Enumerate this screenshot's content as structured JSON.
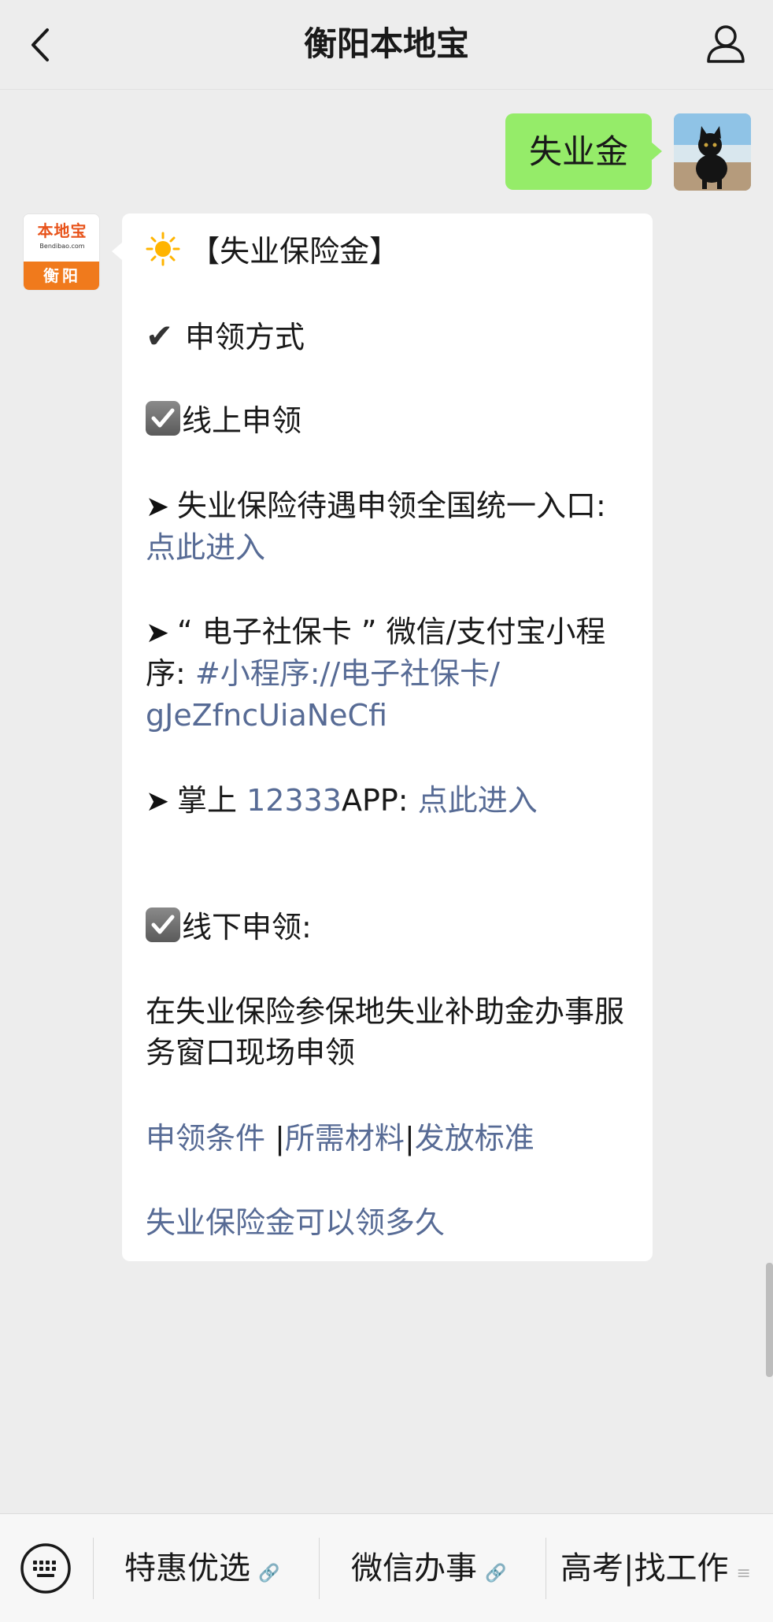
{
  "header": {
    "title": "衡阳本地宝",
    "back_icon": "chevron-left-icon",
    "profile_icon": "person-icon"
  },
  "chat": {
    "user_message": "失业金",
    "bot_avatar": {
      "logo": "本地宝",
      "domain": "Bendibao.com",
      "city": "衡阳"
    },
    "reply": {
      "heading": "【失业保险金】",
      "section": "申领方式",
      "online_title": "线上申领",
      "item1_text": "失业保险待遇申领全国统一入口:",
      "item1_link": "点此进入",
      "item2_prefix": "“ 电子社保卡 ” 微信/支付宝小程",
      "item2_suffix": "序:",
      "item2_link_a": "#小程序://电子社保卡/",
      "item2_link_b": "gJeZfncUiaNeCfi",
      "item3_prefix": "掌上 ",
      "item3_number": "12333",
      "item3_suffix": "APP:",
      "item3_link": "点此进入",
      "offline_title": "线下申领:",
      "offline_text": "在失业保险参保地失业补助金办事服务窗口现场申领",
      "links": [
        "申领条件",
        "所需材料",
        "发放标准"
      ],
      "link_separator": "|",
      "last_link": "失业保险金可以领多久"
    }
  },
  "bottom_menu": {
    "keyboard_icon": "keyboard-icon",
    "items": [
      {
        "label": "特惠优选",
        "icon": "link-icon"
      },
      {
        "label": "微信办事",
        "icon": "link-icon"
      },
      {
        "label": "高考|找工作",
        "icon": "menu-icon"
      }
    ]
  },
  "colors": {
    "background": "#ededed",
    "outgoing_bubble": "#95ec69",
    "incoming_bubble": "#ffffff",
    "link": "#576b95",
    "brand_orange": "#f07a1c"
  }
}
